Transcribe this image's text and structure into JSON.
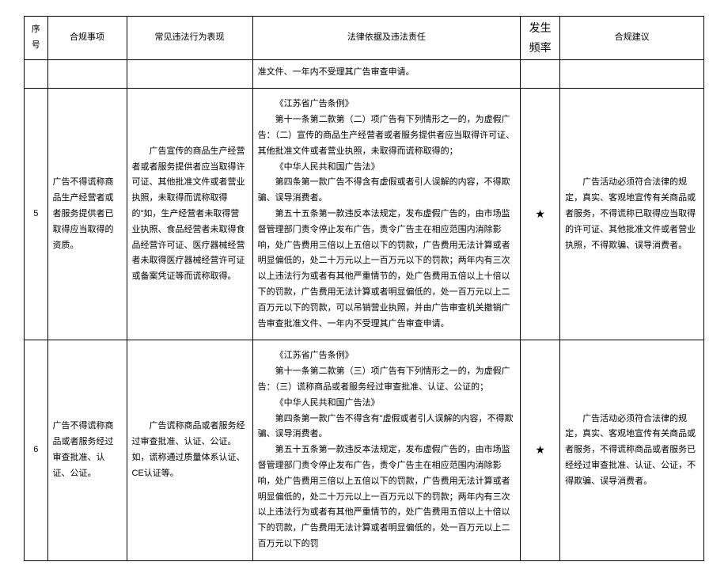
{
  "headers": {
    "seq": "序号",
    "matter": "合规事项",
    "behavior": "常见违法行为表现",
    "legal": "法律依据及违法责任",
    "freq": "发生频率",
    "advice": "合规建议"
  },
  "continuation": {
    "legal": "准文件、一年内不受理其广告审查申请。"
  },
  "rows": [
    {
      "seq": "5",
      "matter": "广告不得谎称商品生产经营者或者服务提供者已取得应当取得的资质。",
      "behavior": "广告宣传的商品生产经营者或者服务提供者应当取得许可证、其他批准文件或者营业执照，未取得而谎称取得的\"如，生产经营者未取得营业执照、食品经营者未取得食品经营许可证、医疗器械经营者未取得医疗器械经营许可证或备案凭证等而谎称取得。",
      "legal_p1": "《江苏省广告条例》",
      "legal_p2": "第十一条第二款第（二）项广告有下列情形之一的，为虚假广告：（二）宣传的商品生产经营者或者服务提供者应当取得许可证、其他批准文件或者营业执照，未取得而谎称取得的；",
      "legal_p3": "《中华人民共和国广告法》",
      "legal_p4": "第四条第一款广告不得含有虚假或者引人误解的内容，不得欺骗、误导消费者。",
      "legal_p5": "第五十五条第一款违反本法规定，发布虚假广告的，由市场监督管理部门责令停止发布广告，责令广告主在相应范围内消除影响，处广告费用三倍以上五倍以下的罚款，广告费用无法计算或者明显偏低的，处二十万元以上一百万元以下的罚款；两年内有三次以上违法行为或者有其他严重情节的，处广告费用五倍以上十倍以下的罚款，广告费用无法计算或者明显偏低的，处一百万元以上二百万元以下的罚款，可以吊销营业执照，并由广告审查机关撤销广告审查批准文件、一年内不受理其广告审查申请。",
      "freq": "★",
      "advice": "广告活动必须符合法律的规定，真实、客观地宣传有关商品或者服务，不得谎称已取得应当取得的许可证、其他批准文件或者营业执照，不得欺骗、误导消费者。"
    },
    {
      "seq": "6",
      "matter": "广告不得谎称商品或者服务经过审查批准、认证、公证。",
      "behavior": "广告谎称商品或者服务经过审查批准、认证、公证。如，谎称通过质量体系认证、CE认证等。",
      "legal_p1": "《江苏省广告条例》",
      "legal_p2": "第十一条第二款第（三）项广告有下列情形之一的，为虚假广告：（三）谎称商品或者服务经过审查批准、认证、公证的；",
      "legal_p3": "《中华人民共和国广告法》",
      "legal_p4": "第四条第一款广告不得含有\"虚假或者引人误解的内容，不得欺骗、误导消费者。",
      "legal_p5": "第五十五条第一款违反本法规定，发布虚假广告的，由市场监督管理部门责令停止发布广告，责令广告主在相应范围内消除影响，处广告费用三倍以上五倍以下的罚款，广告费用无法计算或者明显偏低的，处二十万元以上一百万元以下的罚款；两年内有三次以上违法行为或者有其他严重情节的，处广告费用五倍以上十倍以下的罚款，广告费用无法计算或者明显偏低的，处一百万元以上二百万元以下的罚",
      "freq": "★",
      "advice": "广告活动必须符合法律的规定，真实、客观地宣传有关商品或者服务，不得谎称商品或者服务已经经过审查批准、认证、公证，不得欺骗、误导消费者。"
    }
  ]
}
